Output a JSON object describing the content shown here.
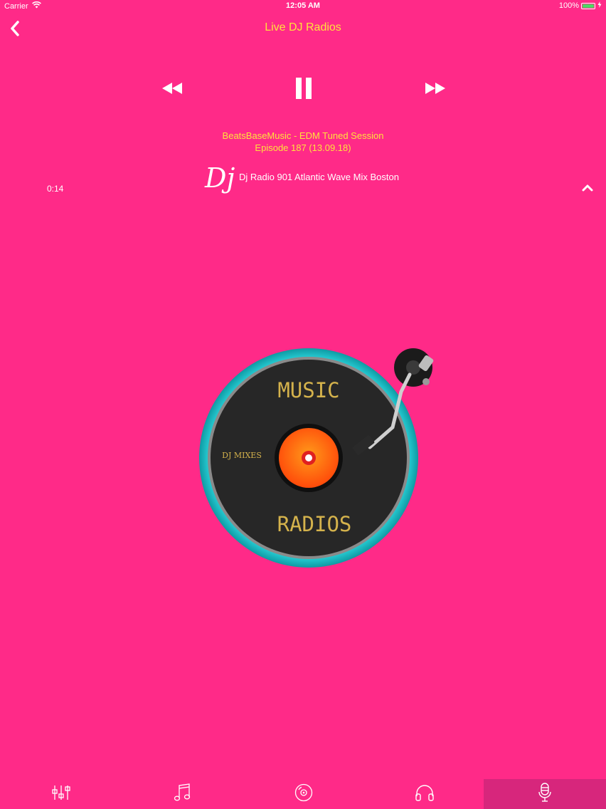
{
  "status_bar": {
    "carrier": "Carrier",
    "time": "12:05 AM",
    "battery": "100%",
    "battery_level": 1.0
  },
  "nav": {
    "title": "Live DJ Radios",
    "back_icon": "chevron-left-icon"
  },
  "player": {
    "controls": [
      "rewind-icon",
      "pause-icon",
      "fast-forward-icon"
    ],
    "track_line1": "BeatsBaseMusic - EDM Tuned Session",
    "track_line2": "Episode 187 (13.09.18)",
    "logo_text": "Dj",
    "station_name": "Dj Radio 901 Atlantic Wave Mix  Boston",
    "elapsed": "0:14"
  },
  "artwork": {
    "top_text": "MUSIC",
    "left_text": "DJ MIXES",
    "bottom_text": "RADIOS"
  },
  "tabs": [
    {
      "icon": "equalizer-icon",
      "selected": false
    },
    {
      "icon": "music-note-icon",
      "selected": false
    },
    {
      "icon": "vinyl-disc-icon",
      "selected": false
    },
    {
      "icon": "headphones-icon",
      "selected": false
    },
    {
      "icon": "microphone-icon",
      "selected": true
    }
  ],
  "colors": {
    "background": "#FF2A88",
    "title_yellow": "#FFE23B",
    "selected_tab": "#D7267C",
    "turntable_ring": "#1FC6CF",
    "label_orange": "#FF5A12"
  }
}
